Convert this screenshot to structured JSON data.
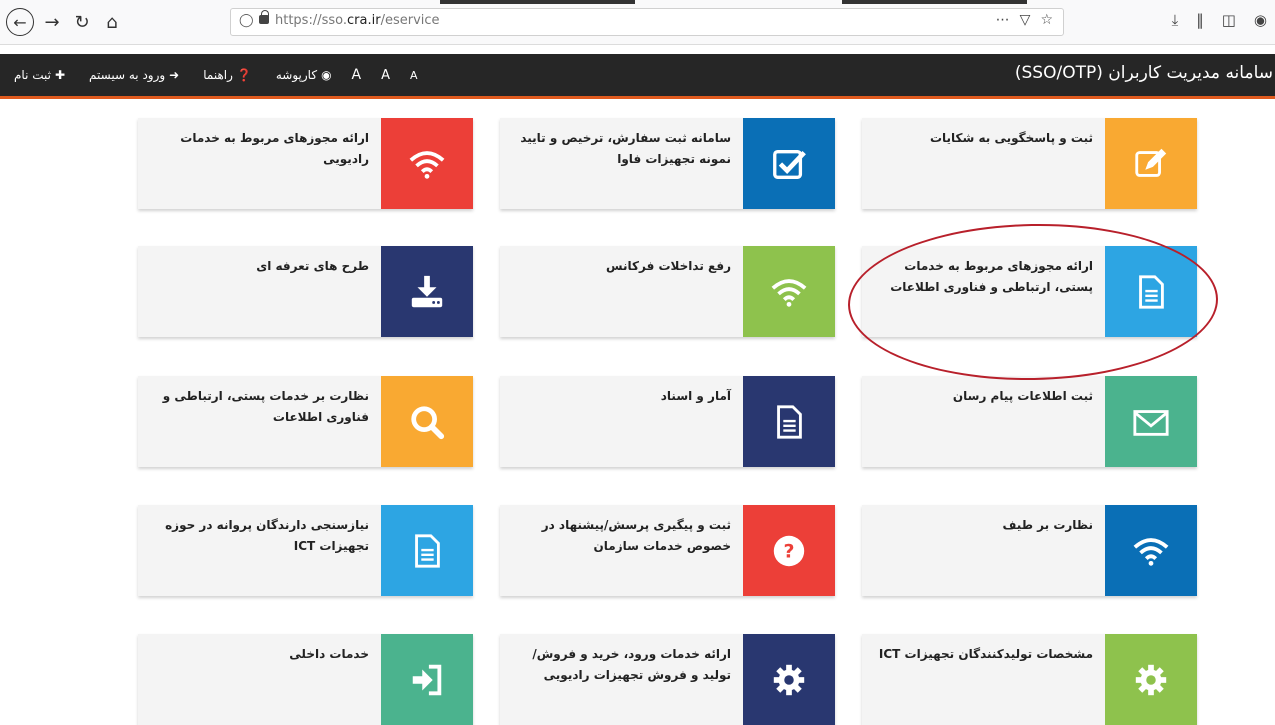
{
  "browser": {
    "url_prefix": "https://sso.",
    "url_domain": "cra.ir",
    "url_path": "/eservice",
    "icons": [
      "back-icon",
      "forward-icon",
      "reload-icon",
      "home-icon",
      "shield-icon",
      "lock-icon",
      "more-icon",
      "pocket-icon",
      "star-icon",
      "download-icon",
      "library-icon",
      "sidebar-icon",
      "account-icon"
    ]
  },
  "header": {
    "title": "سامانه مدیریت کاربران (SSO/OTP)",
    "nav": [
      {
        "label": "ثبت نام"
      },
      {
        "label": "ورود به سیستم"
      },
      {
        "label": "راهنما"
      },
      {
        "label": "کارپوشه"
      }
    ],
    "font_sizes": [
      "A",
      "A",
      "A"
    ]
  },
  "cards": [
    {
      "label": "ثبت و پاسخگویی به شکایات",
      "icon": "edit-icon",
      "color": "#f9a932"
    },
    {
      "label": "سامانه ثبت سفارش، ترخیص و تایید نمونه تجهیزات فاوا",
      "icon": "checkbox-icon",
      "color": "#0a6fb6"
    },
    {
      "label": "ارائه مجوزهای مربوط به خدمات رادیویی",
      "icon": "wifi-icon",
      "color": "#ec3f38"
    },
    {
      "label": "ارائه مجوزهای مربوط به خدمات پستی، ارتباطی و فناوری اطلاعات",
      "icon": "document-icon",
      "color": "#2da5e3"
    },
    {
      "label": "رفع تداخلات فرکانس",
      "icon": "wifi-icon",
      "color": "#8ec24d"
    },
    {
      "label": "طرح های تعرفه ای",
      "icon": "download-drive-icon",
      "color": "#293770"
    },
    {
      "label": "ثبت اطلاعات پیام رسان",
      "icon": "envelope-icon",
      "color": "#4bb38e"
    },
    {
      "label": "آمار و اسناد",
      "icon": "document-icon",
      "color": "#293770"
    },
    {
      "label": "نظارت بر خدمات پستی، ارتباطی و فناوری اطلاعات",
      "icon": "search-icon",
      "color": "#f9a932"
    },
    {
      "label": "نظارت بر طیف",
      "icon": "wifi-icon",
      "color": "#0a6fb6"
    },
    {
      "label": "ثبت و پیگیری پرسش/پیشنهاد در خصوص خدمات سازمان",
      "icon": "question-icon",
      "color": "#ec3f38"
    },
    {
      "label": "نیازسنجی دارندگان پروانه در حوزه تجهیزات ICT",
      "icon": "document-icon",
      "color": "#2da5e3"
    },
    {
      "label": "مشخصات تولیدکنندگان تجهیزات ICT",
      "icon": "gear-icon",
      "color": "#8ec24d"
    },
    {
      "label": "ارائه خدمات ورود، خرید و فروش/تولید و فروش تجهیزات رادیویی",
      "icon": "gear-icon",
      "color": "#293770"
    },
    {
      "label": "خدمات داخلی",
      "icon": "sign-in-icon",
      "color": "#4bb38e"
    }
  ]
}
